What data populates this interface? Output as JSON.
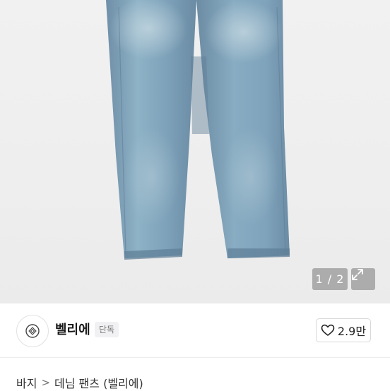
{
  "gallery": {
    "image_name": "denim-pants-photo",
    "counter": "1 / 2",
    "expand_icon": "expand-icon"
  },
  "shop": {
    "name": "벨리에",
    "badge": "단독",
    "logo_icon": "shop-logo-icon"
  },
  "like": {
    "icon": "heart-icon",
    "count": "2.9만"
  },
  "breadcrumb": {
    "category": "바지",
    "separator": ">",
    "subcategory": "데님 팬츠 (벨리에)"
  }
}
